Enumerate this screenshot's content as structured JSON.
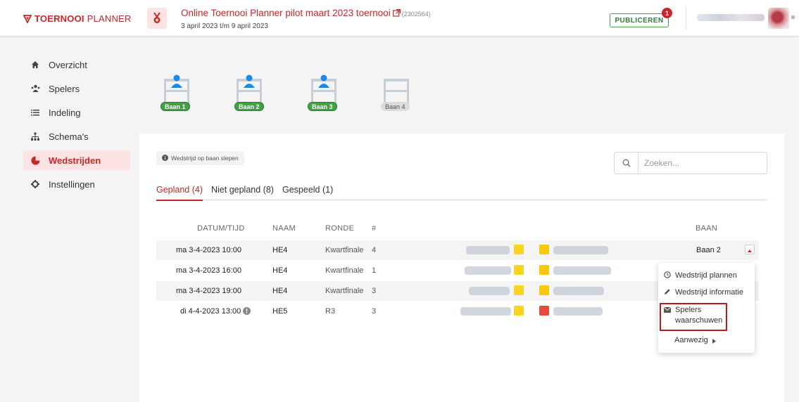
{
  "header": {
    "logo_bold": "TOERNOOI",
    "logo_light": "PLANNER",
    "tournament_title": "Online Toernooi Planner pilot maart 2023 toernooi",
    "tournament_id": "(2302564)",
    "dates": "3 april 2023 t/m 9 april 2023",
    "publish_label": "PUBLICEREN",
    "publish_badge": "1"
  },
  "sidebar": {
    "items": [
      {
        "label": "Overzicht",
        "icon": "home-icon"
      },
      {
        "label": "Spelers",
        "icon": "players-icon"
      },
      {
        "label": "Indeling",
        "icon": "list-icon"
      },
      {
        "label": "Schema's",
        "icon": "bracket-icon"
      },
      {
        "label": "Wedstrijden",
        "icon": "shuttlecock-icon",
        "active": true
      },
      {
        "label": "Instellingen",
        "icon": "gear-icon"
      }
    ]
  },
  "courts": [
    {
      "label": "Baan 1",
      "occupied": true
    },
    {
      "label": "Baan 2",
      "occupied": true
    },
    {
      "label": "Baan 3",
      "occupied": true
    },
    {
      "label": "Baan 4",
      "occupied": false
    }
  ],
  "hint": "Wedstrijd op baan slepen",
  "search": {
    "placeholder": "Zoeken..."
  },
  "tabs": [
    {
      "label": "Gepland (4)",
      "active": true
    },
    {
      "label": "Niet gepland (8)"
    },
    {
      "label": "Gespeeld (1)"
    }
  ],
  "table": {
    "headers": {
      "datetime": "DATUM/TIJD",
      "name": "NAAM",
      "round": "RONDE",
      "number": "#",
      "court": "BAAN"
    },
    "rows": [
      {
        "datetime": "ma 3-4-2023 10:00",
        "name": "HE4",
        "round": "Kwartfinale",
        "number": "4",
        "court": "Baan 2"
      },
      {
        "datetime": "ma 3-4-2023 16:00",
        "name": "HE4",
        "round": "Kwartfinale",
        "number": "1",
        "court": ""
      },
      {
        "datetime": "ma 3-4-2023 19:00",
        "name": "HE4",
        "round": "Kwartfinale",
        "number": "3",
        "court": ""
      },
      {
        "datetime": "di 4-4-2023 13:00",
        "name": "HE5",
        "round": "R3",
        "number": "3",
        "court": ""
      }
    ]
  },
  "menu": {
    "plan": "Wedstrijd plannen",
    "info": "Wedstrijd informatie",
    "warn_line1": "Spelers",
    "warn_line2": "waarschuwen",
    "present": "Aanwezig"
  },
  "colors": {
    "brand": "#c62828",
    "court_used": "#43a047",
    "active_bg": "#fde3e3"
  }
}
